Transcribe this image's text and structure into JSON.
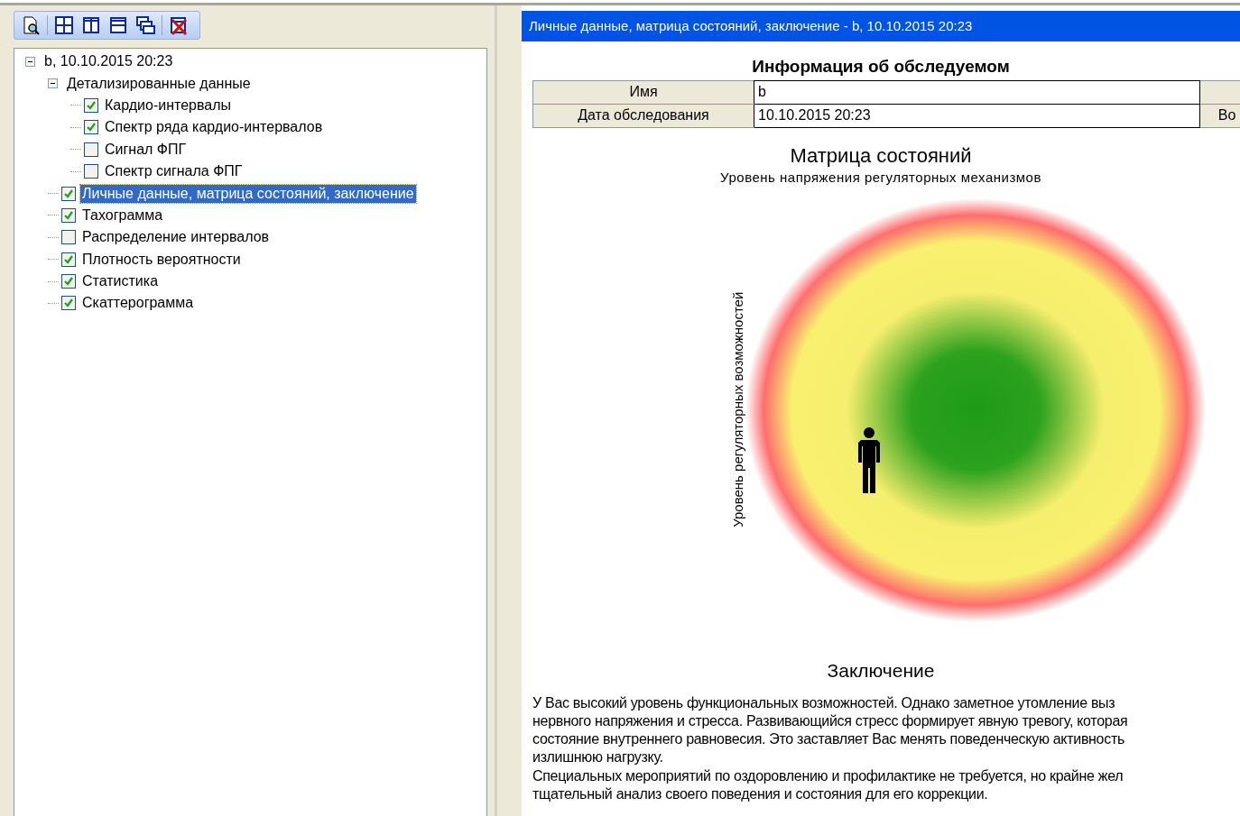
{
  "toolbar": {
    "buttons": [
      {
        "kind": "preview"
      },
      {
        "kind": "grid"
      },
      {
        "kind": "columns"
      },
      {
        "kind": "rows"
      },
      {
        "kind": "cascade"
      },
      {
        "kind": "close_all"
      }
    ]
  },
  "tree": {
    "label": "b, 10.10.2015 20:23",
    "expanded": true,
    "children": [
      {
        "label": "Детализированные данные",
        "expanded": true,
        "children": [
          {
            "label": "Кардио-интервалы",
            "checked": true,
            "selected": false
          },
          {
            "label": "Спектр ряда кардио-интервалов",
            "checked": true,
            "selected": false
          },
          {
            "label": "Сигнал ФПГ",
            "checked": false,
            "selected": false
          },
          {
            "label": "Спектр сигнала ФПГ",
            "checked": false,
            "selected": false
          }
        ]
      },
      {
        "label": "Личные данные, матрица состояний, заключение",
        "checked": true,
        "selected": true
      },
      {
        "label": "Тахограмма",
        "checked": true,
        "selected": false
      },
      {
        "label": "Распределение интервалов",
        "checked": false,
        "selected": false
      },
      {
        "label": "Плотность вероятности",
        "checked": true,
        "selected": false
      },
      {
        "label": "Статистика",
        "checked": true,
        "selected": false
      },
      {
        "label": "Скаттерограмма",
        "checked": true,
        "selected": false
      }
    ]
  },
  "report": {
    "title": "Личные данные, матрица состояний, заключение - b, 10.10.2015 20:23",
    "info_heading": "Информация об обследуемом",
    "info_rows": [
      {
        "label": "Имя",
        "value": "b"
      },
      {
        "label": "Дата обследования",
        "value": "10.10.2015 20:23",
        "column_3": "Во"
      }
    ],
    "matrix_heading": "Матрица состояний",
    "x_axis_label": "Уровень напряжения регуляторных механизмов",
    "y_axis_label": "Уровень регуляторных возможностей",
    "conclusion_heading": "Заключение",
    "conclusion_lines": [
      "У Вас высокий уровень функциональных возможностей. Однако заметное утомление выз",
      "нервного напряжения и стресса. Развивающийся стресс формирует явную тревогу, которая",
      "состояние внутреннего равновесия. Это заставляет Вас менять поведенческую активность",
      "излишнюю нагрузку.",
      "Специальных мероприятий по оздоровлению и профилактике не требуется, но крайне жел",
      "тщательный анализ своего поведения и состояния для его коррекции."
    ]
  }
}
